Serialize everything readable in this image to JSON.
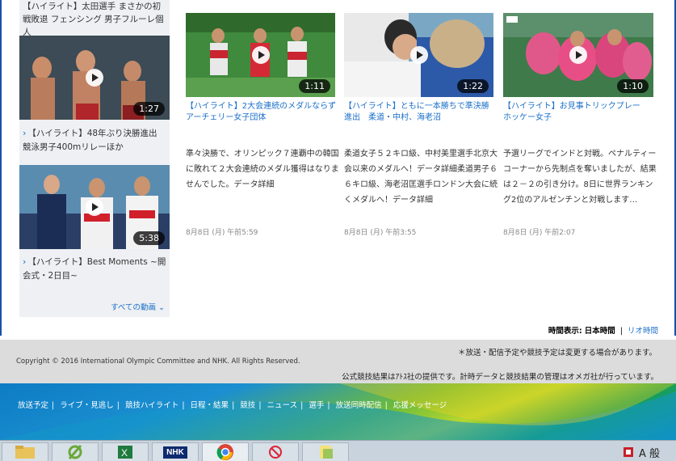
{
  "left_column": {
    "top_caption": "【ハイライト】太田選手 まさかの初戦敗退 フェンシング 男子フルーレ個人",
    "videos": [
      {
        "duration": "1:27",
        "caption": "【ハイライト】48年ぶり決勝進出　競泳男子400mリレーほか"
      },
      {
        "duration": "5:38",
        "caption": "【ハイライト】Best Moments ~開会式・2日目~"
      }
    ],
    "all_videos_label": "すべての動画 ⌄"
  },
  "cards": [
    {
      "duration": "1:11",
      "title": "【ハイライト】2大会連続のメダルならず　アーチェリー女子団体",
      "description": "準々決勝で、オリンピック７連覇中の韓国に敗れて２大会連続のメダル獲得はなりませんでした。データ詳細",
      "date": "8月8日 (月) 午前5:59"
    },
    {
      "duration": "1:22",
      "title": "【ハイライト】ともに一本勝ちで準決勝進出　柔道・中村、海老沼",
      "description": "柔道女子５２キロ級、中村美里選手北京大会以来のメダルへ！データ詳細柔道男子６６キロ級、海老沼匡選手ロンドン大会に続くメダルへ！データ詳細",
      "date": "8月8日 (月) 午前3:55"
    },
    {
      "duration": "1:10",
      "title": "【ハイライト】お見事トリックプレー　ホッケー女子",
      "description": "予選リーグでインドと対戦。ペナルティーコーナーから先制点を奪いましたが、結果は２－２の引き分け。8日に世界ランキング2位のアルゼンチンと対戦します…",
      "date": "8月8日 (月) 午前2:07"
    }
  ],
  "timezone": {
    "label": "時間表示:",
    "japan": "日本時間",
    "separator": "|",
    "rio": "リオ時間"
  },
  "footer": {
    "notice1": "＊放送・配信予定や競技予定は変更する場合があります。",
    "copyright": "Copyright © 2016 International Olympic Committee and NHK. All Rights Reserved.",
    "notice2": "公式競技結果はｱﾄｽ社の提供です。計時データと競技結果の管理はオメガ社が行っています。",
    "nav": [
      "放送予定",
      "ライブ・見逃し",
      "競技ハイライト",
      "日程・結果",
      "競技",
      "ニュース",
      "選手",
      "放送同時配信",
      "応援メッセージ"
    ]
  },
  "taskbar": {
    "nhk_label": "NHK",
    "tray_text": "A 般"
  },
  "colors": {
    "link": "#1a6fc8",
    "taskbar": "#c9d3dd",
    "footer_gray": "#dcdcdc"
  }
}
